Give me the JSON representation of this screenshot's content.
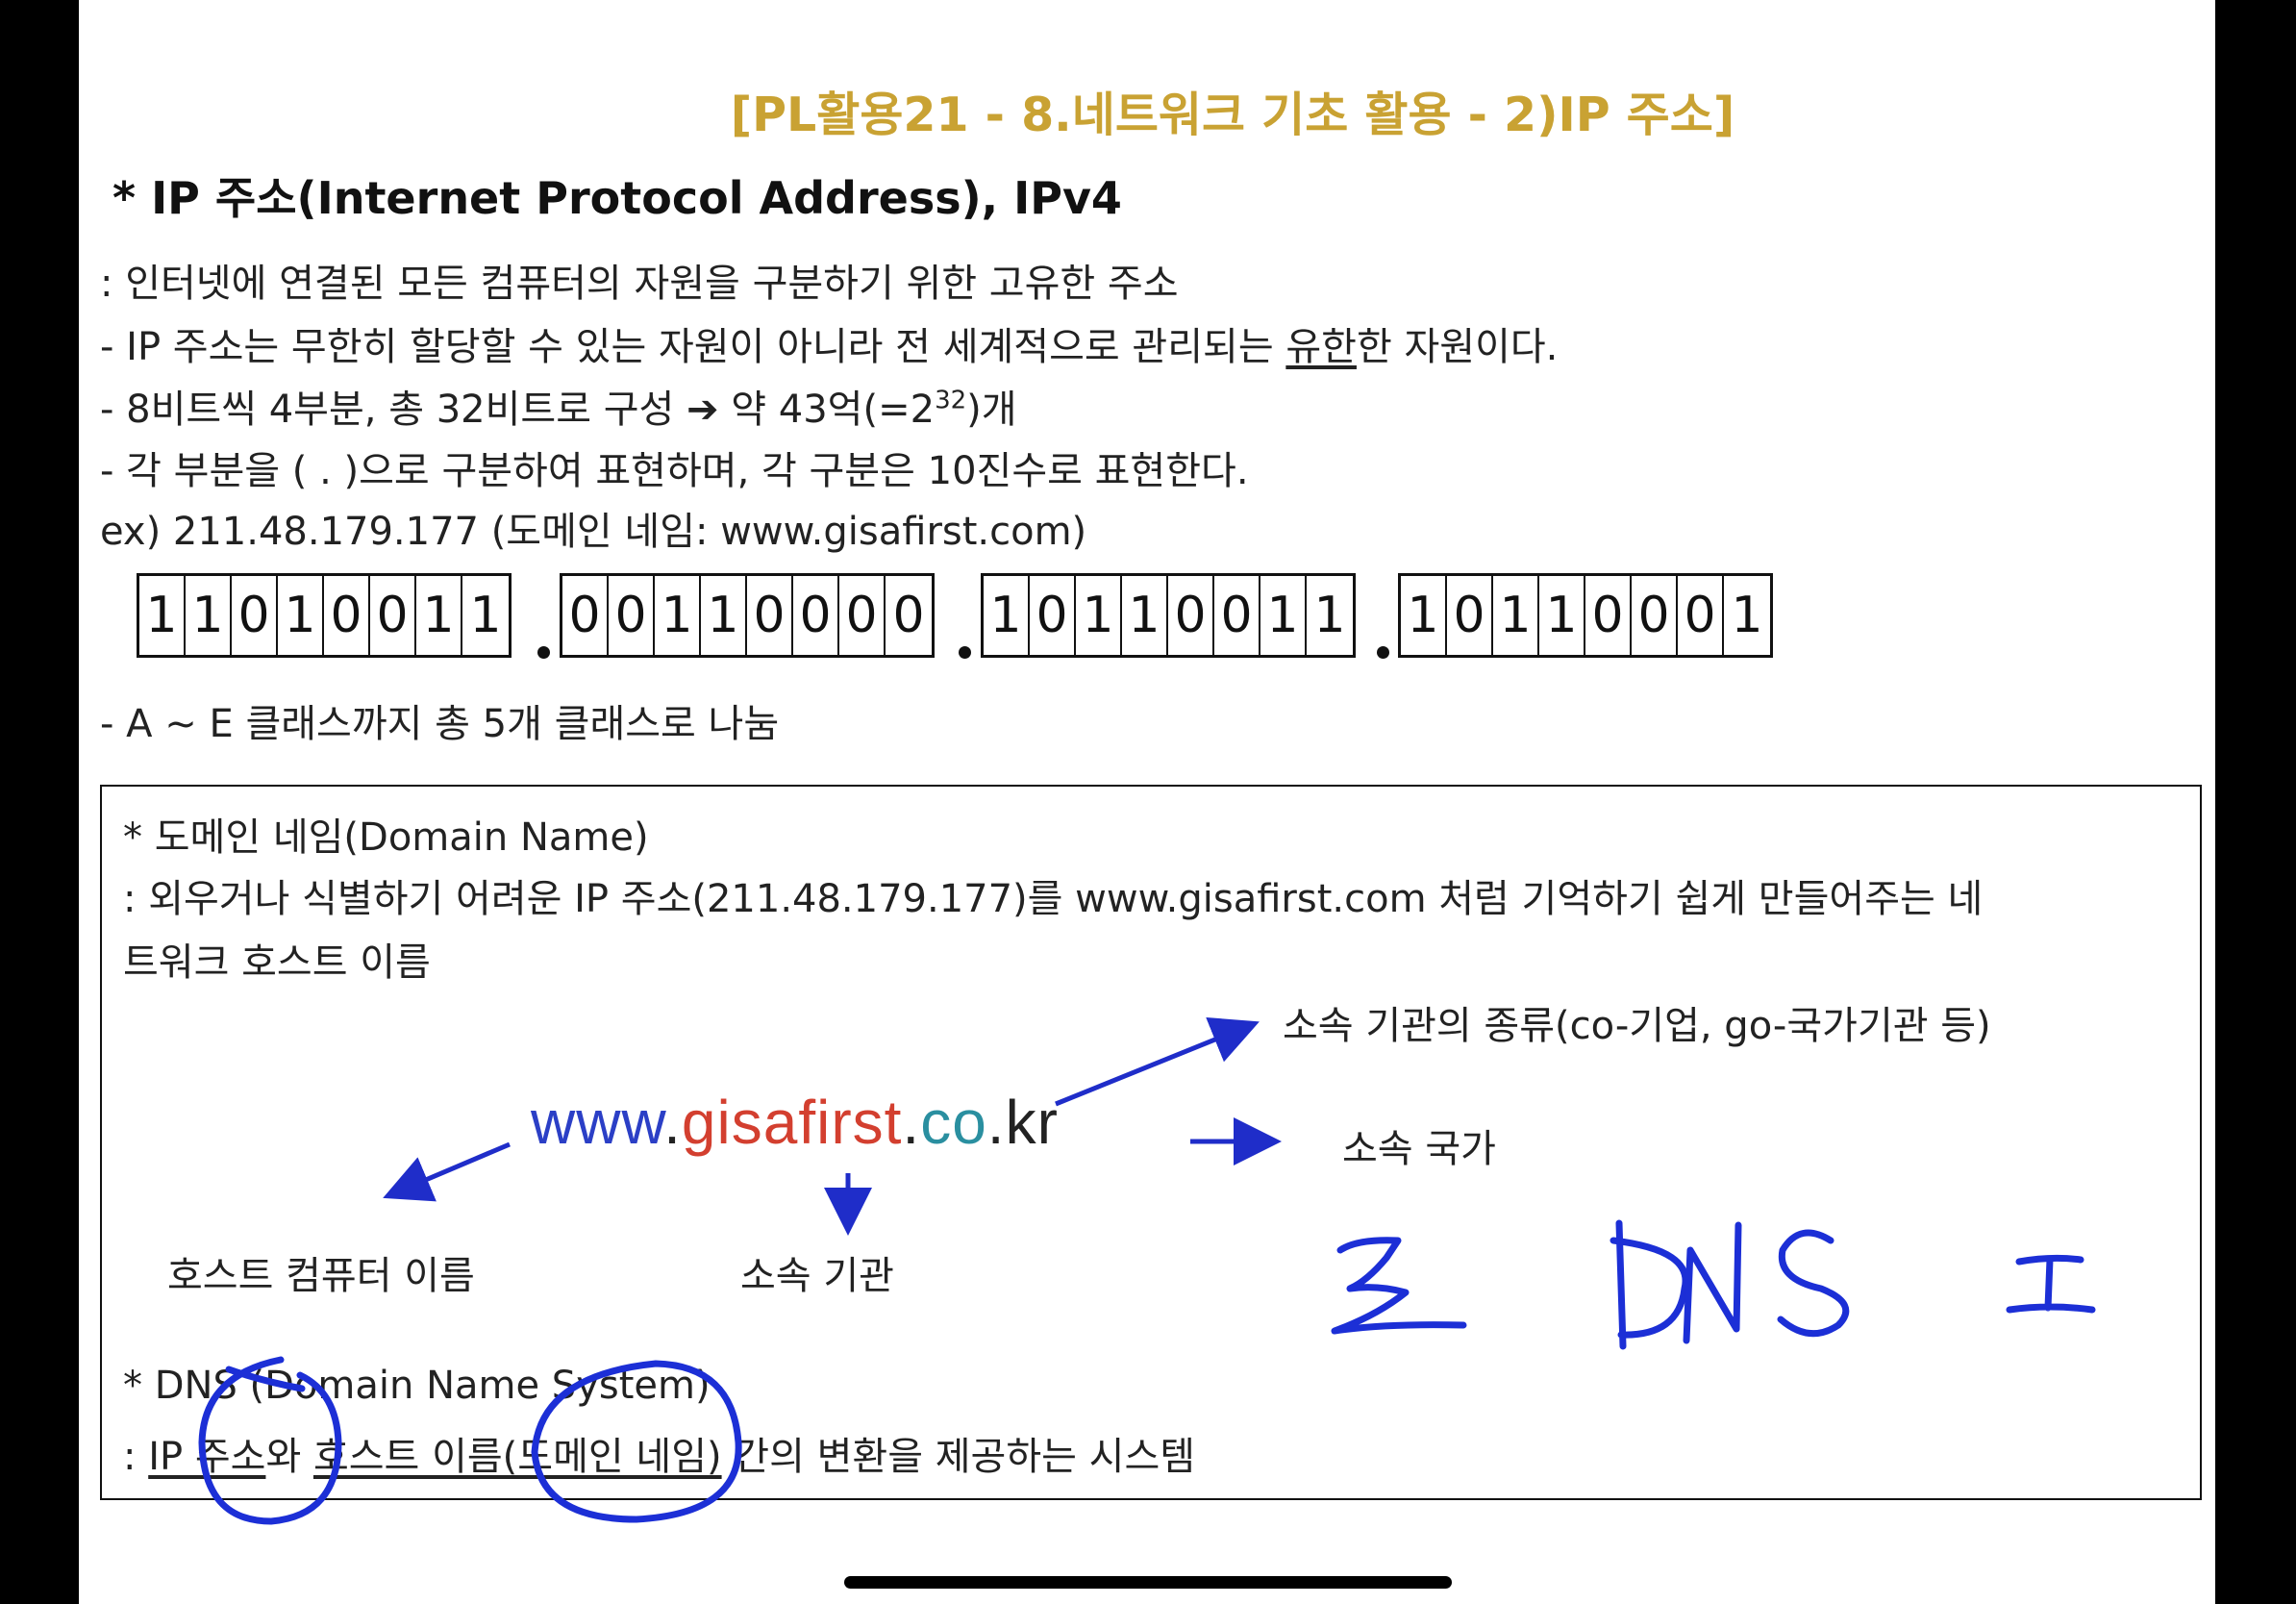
{
  "document": {
    "title": "[PL활용21 - 8.네트워크 기초 활용 - 2)IP 주소]",
    "heading": "* IP 주소(Internet Protocol Address), IPv4",
    "lines": [
      ": 인터넷에 연결된 모든 컴퓨터의 자원을 구분하기 위한 고유한 주소",
      "- IP 주소는 무한히 할당할 수 있는 자원이 아니라 전 세계적으로 관리되는 ",
      "유한",
      "한 자원이다.",
      "- 8비트씩 4부분, 총 32비트로 구성 ➔ 약 43억(=2",
      "32",
      ")개",
      "- 각 부분을 ( . )으로 구분하여 표현하며, 각 구분은 10진수로 표현한다.",
      "ex) 211.48.179.177 (도메인 네임: www.gisafirst.com)",
      "- A ~ E 클래스까지 총 5개 클래스로 나눔"
    ],
    "binary_octets": [
      [
        "1",
        "1",
        "0",
        "1",
        "0",
        "0",
        "1",
        "1"
      ],
      [
        "0",
        "0",
        "1",
        "1",
        "0",
        "0",
        "0",
        "0"
      ],
      [
        "1",
        "0",
        "1",
        "1",
        "0",
        "0",
        "1",
        "1"
      ],
      [
        "1",
        "0",
        "1",
        "1",
        "0",
        "0",
        "0",
        "1"
      ]
    ]
  },
  "domain_box": {
    "heading": "* 도메인 네임(Domain Name)",
    "desc_line1": ": 외우거나 식별하기 어려운 IP 주소(211.48.179.177)를 www.gisafirst.com 처럼 기억하기 쉽게 만들어주는 네",
    "desc_line2": "트워크 호스트 이름",
    "domain_parts": [
      "www",
      ".",
      "gisafirst",
      ".",
      "co",
      ".",
      "kr"
    ],
    "label_org_type": "소속 기관의 종류(co-기업, go-국가기관 등)",
    "label_country": "소속 국가",
    "label_host": "호스트 컴퓨터 이름",
    "label_org": "소속 기관",
    "dns_heading": "* DNS (Domain Name System)",
    "dns_desc": [
      ": ",
      "IP 주소",
      "와 ",
      "호스트 이름(도메인 네임)",
      " 간의 변환을 제공하는 시스템"
    ]
  },
  "annotation_handwriting": "3 DNS I",
  "colors": {
    "title": "#c9a233",
    "blue": "#1f2dc9",
    "red": "#d33f2f",
    "teal": "#2a8fa0",
    "ink": "#1c2fd6"
  }
}
